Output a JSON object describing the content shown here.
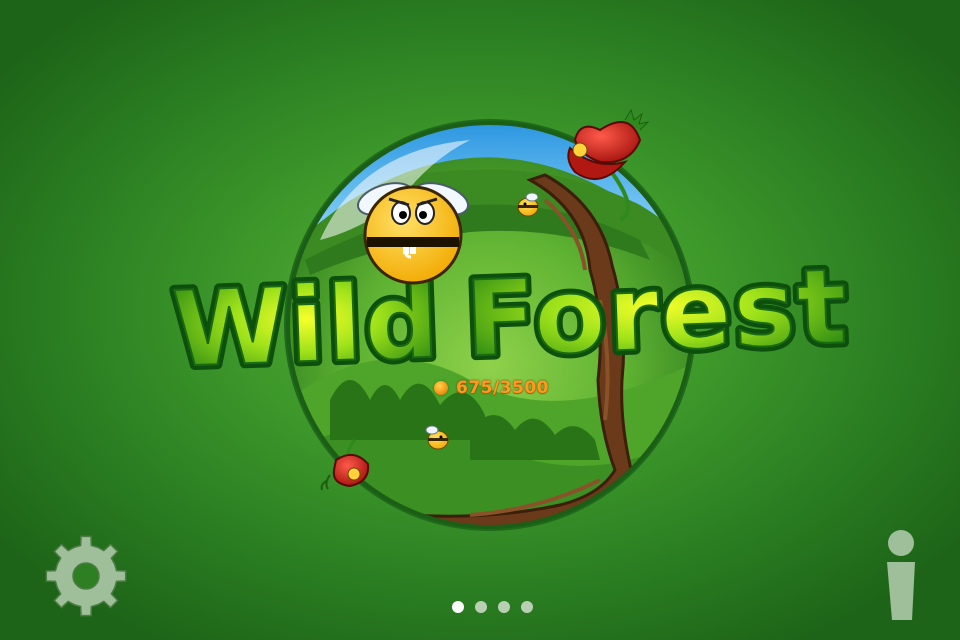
{
  "game": {
    "title_part1": "Wild",
    "title_part2": "Forest",
    "score": "675/3500"
  },
  "controls": {
    "settings_icon": "gear-icon",
    "info_icon": "info-icon"
  },
  "pager": {
    "total_pages": 4,
    "active_page": 1
  },
  "colors": {
    "background": "#3f9a2b",
    "score_text": "#ff9a1f",
    "icon_tint": "#9fbf9a",
    "title_fill": "#7ccf17"
  }
}
